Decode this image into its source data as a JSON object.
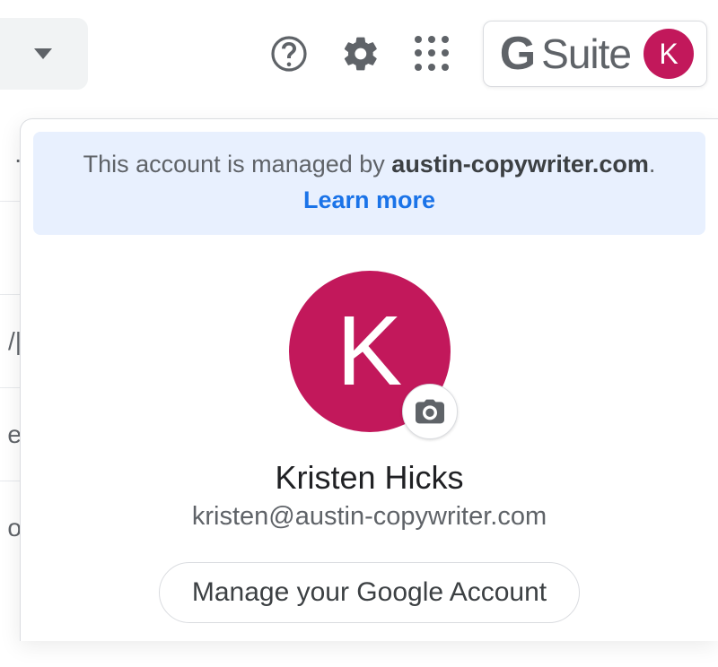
{
  "toolbar": {
    "gsuite_label_g": "G",
    "gsuite_label_suite": "Suite"
  },
  "avatar": {
    "letter": "K",
    "bg": "#c2185b"
  },
  "banner": {
    "prefix": "This account is managed by ",
    "domain": "austin-copywriter.com",
    "suffix": ".",
    "learn_more": "Learn more"
  },
  "profile": {
    "name": "Kristen Hicks",
    "email": "kristen@austin-copywriter.com",
    "manage_label": "Manage your Google Account"
  },
  "bg_rows": [
    ".",
    "",
    "/|",
    "e",
    "o"
  ]
}
